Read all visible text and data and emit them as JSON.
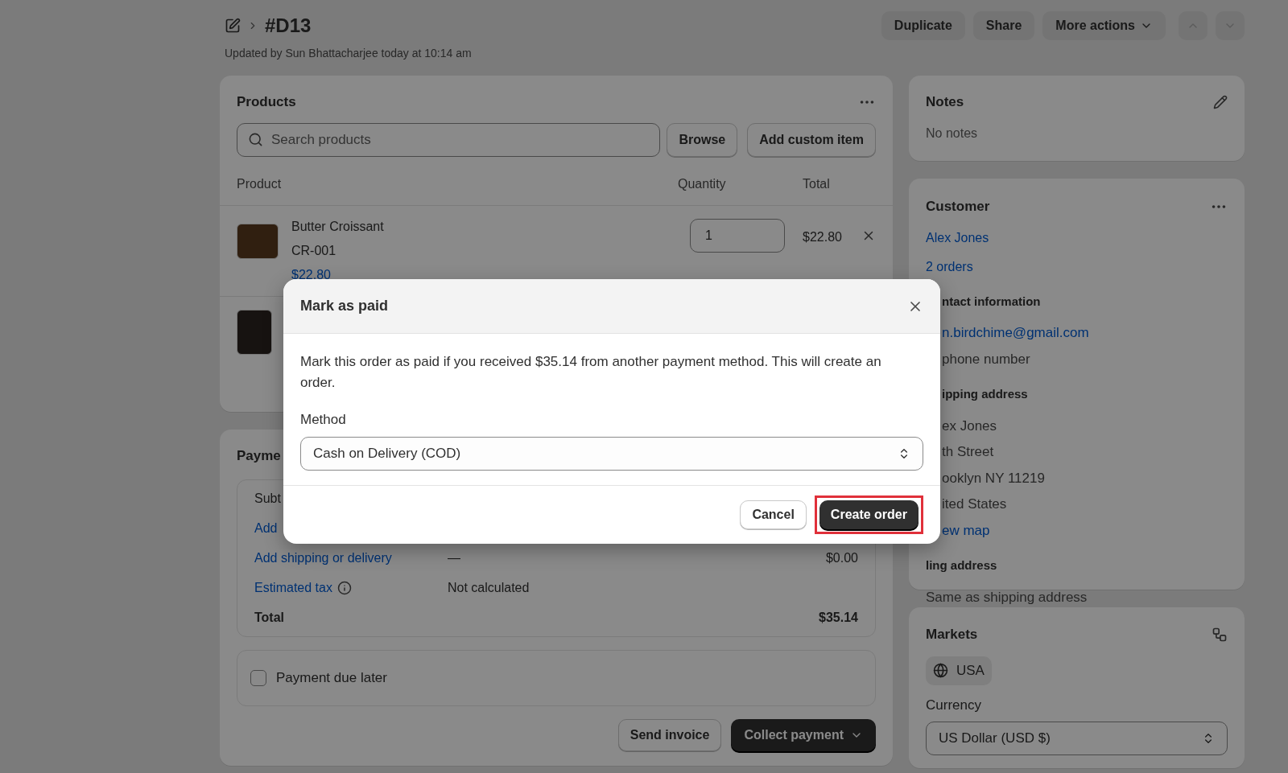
{
  "header": {
    "title": "#D13",
    "subtitle": "Updated by Sun Bhattacharjee today at 10:14 am",
    "actions": [
      "Duplicate",
      "Share",
      "More actions"
    ]
  },
  "products": {
    "title": "Products",
    "search_placeholder": "Search products",
    "buttons": [
      "Browse",
      "Add custom item"
    ],
    "columns": [
      "Product",
      "Quantity",
      "Total"
    ],
    "items": [
      {
        "name": "Butter Croissant",
        "sku": "CR-001",
        "price": "$22.80",
        "quantity": "1",
        "total": "$22.80"
      }
    ]
  },
  "payment": {
    "title": "Payme",
    "rows": [
      {
        "kind": "plain",
        "label": "Subt"
      },
      {
        "kind": "link",
        "label": "Add"
      },
      {
        "kind": "link",
        "label": "Add shipping or delivery",
        "value": "—",
        "amount": "$0.00"
      },
      {
        "kind": "link",
        "label": "Estimated tax",
        "info": true,
        "value": "Not calculated"
      },
      {
        "kind": "total",
        "label": "Total",
        "amount": "$35.14"
      }
    ],
    "due_later": {
      "label": "Payment due later",
      "checked": false
    },
    "buttons": [
      "Send invoice",
      "Collect payment"
    ]
  },
  "notes": {
    "title": "Notes",
    "text": "No notes"
  },
  "customer": {
    "title": "Customer",
    "name": "Alex Jones",
    "orders": "2 orders",
    "sections": [
      {
        "heading": "ntact information",
        "lines": [
          {
            "kind": "link",
            "text": "n.birdchime@gmail.com"
          },
          {
            "kind": "plain",
            "text": "phone number"
          }
        ]
      },
      {
        "heading": "ipping address",
        "lines": [
          {
            "kind": "plain",
            "text": "ex Jones"
          },
          {
            "kind": "plain",
            "text": "th Street"
          },
          {
            "kind": "plain",
            "text": "ooklyn NY 11219"
          },
          {
            "kind": "plain",
            "text": "ited States"
          },
          {
            "kind": "link",
            "text": "ew map"
          }
        ]
      },
      {
        "heading": "ling address",
        "lines": [
          {
            "kind": "plain",
            "text": "Same as shipping address"
          }
        ]
      }
    ]
  },
  "markets": {
    "title": "Markets",
    "market": "USA",
    "currency_label": "Currency",
    "currency": "US Dollar (USD $)"
  },
  "modal": {
    "title": "Mark as paid",
    "message": "Mark this order as paid if you received $35.14 from another payment method. This will create an order.",
    "method_label": "Method",
    "method": "Cash on Delivery (COD)",
    "buttons": [
      {
        "label": "Cancel",
        "kind": "secondary",
        "highlighted": false
      },
      {
        "label": "Create order",
        "kind": "primary",
        "highlighted": true
      }
    ]
  }
}
